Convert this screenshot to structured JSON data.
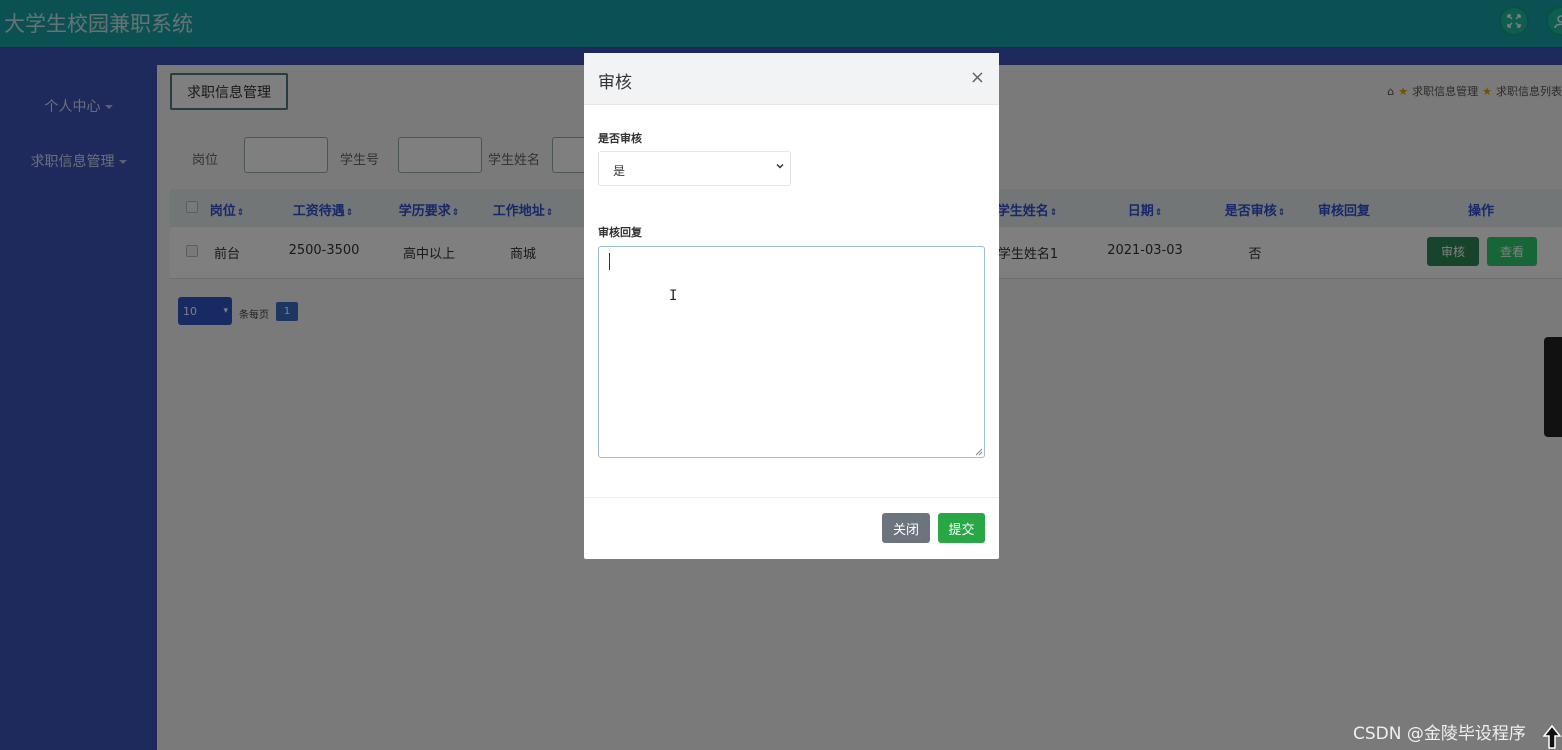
{
  "app": {
    "title": "大学生校园兼职系统"
  },
  "colors": {
    "header": "#16a3a8",
    "sidebar": "#3d55b8",
    "accent": "#1abc9c",
    "primary_dark": "#2e8b57"
  },
  "header": {
    "icons": [
      "fullscreen-icon",
      "user-icon"
    ]
  },
  "sidebar": {
    "items": [
      {
        "label": "个人中心"
      },
      {
        "label": "求职信息管理"
      }
    ]
  },
  "main": {
    "section_button": "求职信息管理",
    "breadcrumb": {
      "home_icon": "home-icon",
      "items": [
        "求职信息管理",
        "求职信息列表"
      ]
    },
    "search": {
      "fields": [
        {
          "label": "岗位",
          "value": ""
        },
        {
          "label": "学生号",
          "value": ""
        },
        {
          "label": "学生姓名",
          "value": ""
        }
      ]
    },
    "table": {
      "columns_left": [
        "岗位",
        "工资待遇",
        "学历要求",
        "工作地址"
      ],
      "columns_right": [
        "学生姓名",
        "日期",
        "是否审核",
        "审核回复",
        "操作"
      ],
      "sort_glyph": "⇕",
      "rows": [
        {
          "left": [
            "前台",
            "2500-3500",
            "高中以上",
            "商城"
          ],
          "right": [
            "学生姓名1",
            "2021-03-03",
            "否",
            ""
          ],
          "actions": [
            "审核",
            "查看"
          ]
        }
      ]
    },
    "pagination": {
      "page_size": "10",
      "per_page_label": "条每页",
      "current_page": "1"
    }
  },
  "modal": {
    "title": "审核",
    "close_glyph": "×",
    "fields": {
      "audit_label": "是否审核",
      "audit_value": "是",
      "reply_label": "审核回复",
      "reply_value": ""
    },
    "buttons": {
      "close": "关闭",
      "submit": "提交"
    }
  },
  "watermark": "CSDN @金陵毕设程序"
}
